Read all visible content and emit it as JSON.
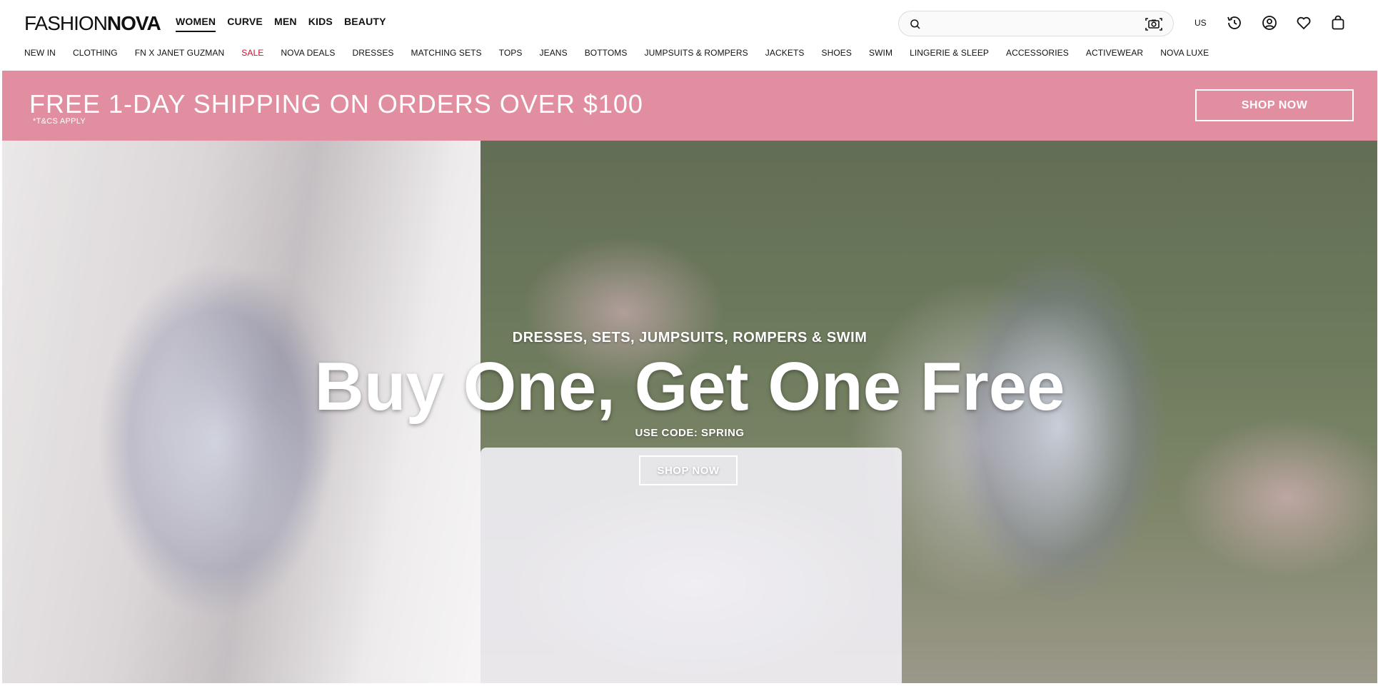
{
  "brand": {
    "logo_light": "FASHION",
    "logo_bold": "NOVA"
  },
  "departments": [
    {
      "label": "WOMEN",
      "active": true
    },
    {
      "label": "CURVE"
    },
    {
      "label": "MEN"
    },
    {
      "label": "KIDS"
    },
    {
      "label": "BEAUTY"
    }
  ],
  "search": {
    "placeholder": "",
    "value": ""
  },
  "region": "US",
  "header_icons": [
    "search-icon",
    "camera-search-icon",
    "recently-viewed-icon",
    "account-icon",
    "wishlist-heart-icon",
    "shopping-bag-icon"
  ],
  "categories": [
    "NEW IN",
    "CLOTHING",
    "FN X JANET GUZMAN",
    "SALE",
    "NOVA DEALS",
    "DRESSES",
    "MATCHING SETS",
    "TOPS",
    "JEANS",
    "BOTTOMS",
    "JUMPSUITS & ROMPERS",
    "JACKETS",
    "SHOES",
    "SWIM",
    "LINGERIE & SLEEP",
    "ACCESSORIES",
    "ACTIVEWEAR",
    "NOVA LUXE"
  ],
  "promo": {
    "headline": "FREE 1-DAY SHIPPING ON ORDERS OVER $100",
    "terms": "*T&CS APPLY",
    "button": "SHOP NOW",
    "bg_color": "#e18ea0"
  },
  "hero": {
    "subtitle": "DRESSES, SETS, JUMPSUITS, ROMPERS & SWIM",
    "headline": "Buy One, Get One Free",
    "code": "USE CODE: SPRING",
    "button": "SHOP NOW"
  },
  "colors": {
    "sale": "#c8102e",
    "text": "#111111"
  }
}
